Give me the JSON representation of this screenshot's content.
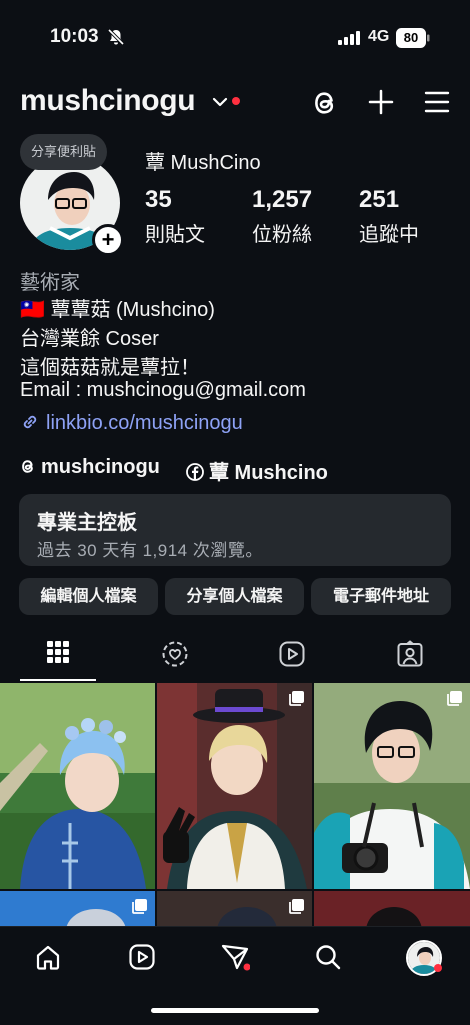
{
  "status_bar": {
    "time": "10:03",
    "network": "4G",
    "battery": "80"
  },
  "header": {
    "username": "mushcinogu"
  },
  "profile": {
    "note": "分享便利貼",
    "display_name": "蕈 MushCino",
    "stats": [
      {
        "value": "35",
        "label": "則貼文"
      },
      {
        "value": "1,257",
        "label": "位粉絲"
      },
      {
        "value": "251",
        "label": "追蹤中"
      }
    ],
    "category": "藝術家",
    "bio": [
      "🇹🇼 蕈蕈菇 (Mushcino)",
      "台灣業餘 Coser",
      "這個菇菇就是蕈拉！",
      "Email : mushcinogu@gmail.com"
    ],
    "link": "linkbio.co/mushcinogu",
    "threads_handle": "mushcinogu",
    "facebook_name": "蕈 Mushcino"
  },
  "dashboard": {
    "title": "專業主控板",
    "subtitle": "過去 30 天有 1,914 次瀏覽。"
  },
  "actions": {
    "edit": "編輯個人檔案",
    "share": "分享個人檔案",
    "email": "電子郵件地址"
  },
  "tabs": [
    "grid-icon",
    "reels-circle-icon",
    "reels-icon",
    "tagged-icon"
  ],
  "colors": {
    "background": "#0c0f14",
    "surface": "#25292e",
    "link": "#8ea2f5",
    "notification": "#ff3040"
  }
}
